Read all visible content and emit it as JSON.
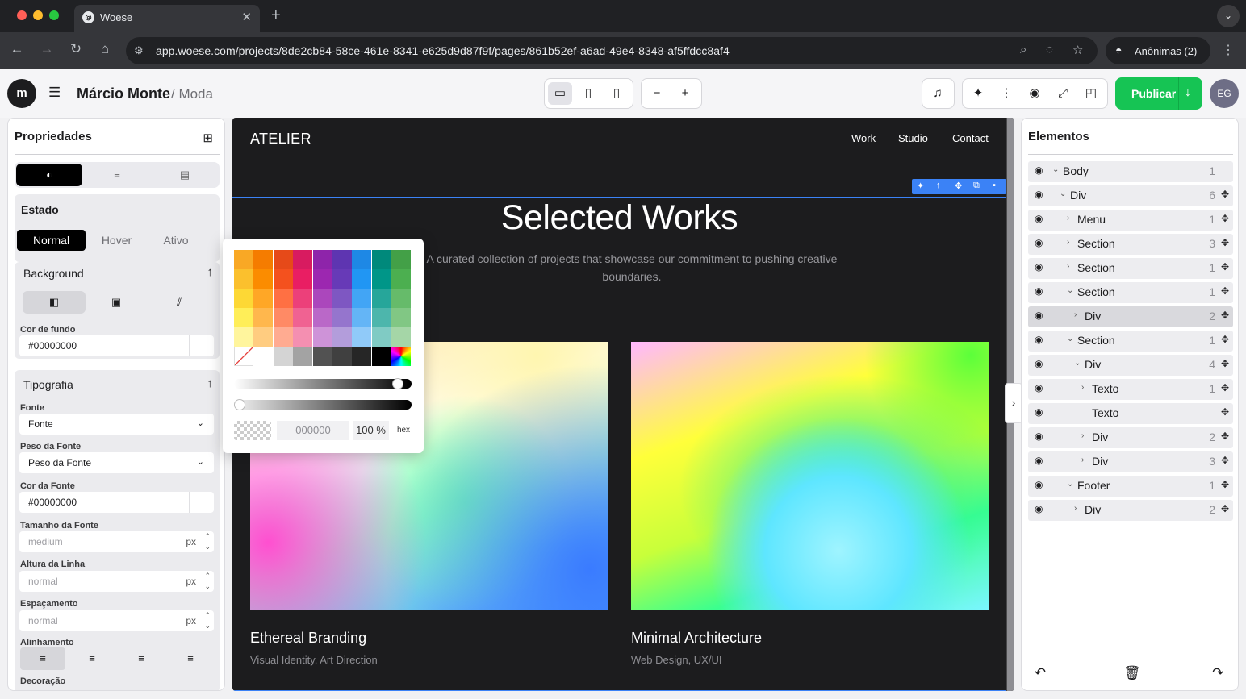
{
  "browser": {
    "tab_title": "Woese",
    "url": "app.woese.com/projects/8de2cb84-58ce-461e-8341-e625d9d87f9f/pages/861b52ef-a6ad-49e4-8348-af5ffdcc8af4",
    "profile_label": "Anônimas (2)"
  },
  "header": {
    "logo_text": "m",
    "project_name": "Márcio Monte",
    "page_name": "/ Moda",
    "publish_label": "Publicar",
    "avatar_initials": "EG"
  },
  "left_panel": {
    "title": "Propriedades",
    "state": {
      "title": "Estado",
      "options": [
        "Normal",
        "Hover",
        "Ativo"
      ],
      "selected": "Normal"
    },
    "background": {
      "title": "Background",
      "color_label": "Cor de fundo",
      "color_value": "#00000000"
    },
    "typography": {
      "title": "Tipografia",
      "font_label": "Fonte",
      "font_value": "Fonte",
      "weight_label": "Peso da Fonte",
      "weight_value": "Peso da Fonte",
      "color_label": "Cor da Fonte",
      "color_value": "#00000000",
      "size_label": "Tamanho da Fonte",
      "size_placeholder": "medium",
      "line_label": "Altura da Linha",
      "line_placeholder": "normal",
      "spacing_label": "Espaçamento",
      "spacing_placeholder": "normal",
      "unit": "px",
      "align_label": "Alinhamento",
      "decoration_label": "Decoração"
    }
  },
  "color_picker": {
    "hex": "000000",
    "opacity": "100 %",
    "mode": "hex",
    "swatches": [
      [
        "#f9a825",
        "#f57c00",
        "#e64a19",
        "#d81b60",
        "#8e24aa",
        "#5e35b1",
        "#1e88e5",
        "#00897b",
        "#43a047"
      ],
      [
        "#fbc02d",
        "#fb8c00",
        "#f4511e",
        "#e91e63",
        "#9c27b0",
        "#673ab7",
        "#2196f3",
        "#009688",
        "#4caf50"
      ],
      [
        "#fdd835",
        "#ffa726",
        "#ff7043",
        "#ec407a",
        "#ab47bc",
        "#7e57c2",
        "#42a5f5",
        "#26a69a",
        "#66bb6a"
      ],
      [
        "#ffee58",
        "#ffb74d",
        "#ff8a65",
        "#f06292",
        "#ba68c8",
        "#9575cd",
        "#64b5f6",
        "#4db6ac",
        "#81c784"
      ],
      [
        "#fff59d",
        "#ffcc80",
        "#ffab91",
        "#f48fb1",
        "#ce93d8",
        "#b39ddb",
        "#90caf9",
        "#80cbc4",
        "#a5d6a7"
      ],
      [
        "none",
        "#ffffff",
        "#d4d4d4",
        "#a3a3a3",
        "#525252",
        "#404040",
        "#262626",
        "#000000",
        "spectrum"
      ]
    ]
  },
  "site": {
    "brand": "ATELIER",
    "nav": [
      "Work",
      "Studio",
      "Contact"
    ],
    "title": "Selected Works",
    "subtitle": "A curated collection of projects that showcase our commitment to pushing creative boundaries.",
    "cards": [
      {
        "title": "Ethereal Branding",
        "tags": "Visual Identity, Art Direction"
      },
      {
        "title": "Minimal Architecture",
        "tags": "Web Design, UX/UI"
      }
    ]
  },
  "right_panel": {
    "title": "Elementos",
    "tree": [
      {
        "name": "Body",
        "count": "1",
        "depth": 0,
        "caret": "open",
        "move": false
      },
      {
        "name": "Div",
        "count": "6",
        "depth": 1,
        "caret": "open",
        "move": true
      },
      {
        "name": "Menu",
        "count": "1",
        "depth": 2,
        "caret": "closed",
        "move": true
      },
      {
        "name": "Section",
        "count": "3",
        "depth": 2,
        "caret": "closed",
        "move": true
      },
      {
        "name": "Section",
        "count": "1",
        "depth": 2,
        "caret": "closed",
        "move": true
      },
      {
        "name": "Section",
        "count": "1",
        "depth": 2,
        "caret": "open",
        "move": true
      },
      {
        "name": "Div",
        "count": "2",
        "depth": 3,
        "caret": "closed",
        "move": true,
        "selected": true
      },
      {
        "name": "Section",
        "count": "1",
        "depth": 2,
        "caret": "open",
        "move": true
      },
      {
        "name": "Div",
        "count": "4",
        "depth": 3,
        "caret": "open",
        "move": true
      },
      {
        "name": "Texto",
        "count": "1",
        "depth": 4,
        "caret": "closed",
        "move": true
      },
      {
        "name": "Texto",
        "count": "",
        "depth": 4,
        "caret": "none",
        "move": true
      },
      {
        "name": "Div",
        "count": "2",
        "depth": 4,
        "caret": "closed",
        "move": true
      },
      {
        "name": "Div",
        "count": "3",
        "depth": 4,
        "caret": "closed",
        "move": true
      },
      {
        "name": "Footer",
        "count": "1",
        "depth": 2,
        "caret": "open",
        "move": true
      },
      {
        "name": "Div",
        "count": "2",
        "depth": 3,
        "caret": "closed",
        "move": true
      }
    ]
  },
  "colors": {
    "accent": "#3b82f6",
    "publish": "#16c454",
    "canvas_bg": "#1c1c1e"
  }
}
